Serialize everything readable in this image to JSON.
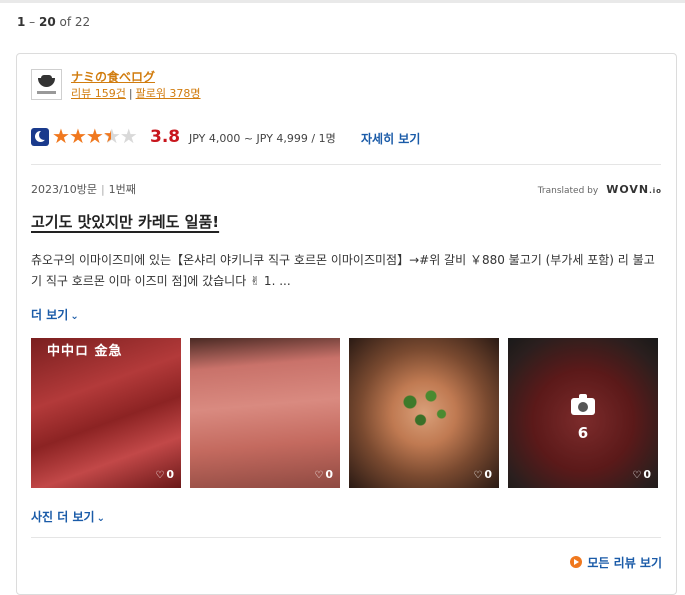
{
  "pagination": {
    "range_start": "1",
    "range_sep": " – ",
    "range_end": "20",
    "of_label": " of 22"
  },
  "reviewer": {
    "name": "ナミの食べログ",
    "reviews_label": "리뷰 159건",
    "followers_label": "팔로워 378명",
    "separator": "|"
  },
  "rating": {
    "stars": 3.8,
    "score": "3.8",
    "price_range": "JPY 4,000 ~ JPY 4,999 / 1명",
    "detail_link": "자세히 보기"
  },
  "visit": {
    "date": "2023/10방문",
    "separator": "|",
    "count": "1번째"
  },
  "translation": {
    "label": "Translated by",
    "brand": "WOVN",
    "brand_suffix": ".io"
  },
  "review": {
    "title": "고기도 맛있지만 카레도 일품!",
    "body": "츄오구의 이마이즈미에 있는【온샤리 야키니쿠 직구 호르몬 이마이즈미점】→#위 갈비 ￥880 불고기 (부가세 포함) 리 불고기 직구 호르몬 이마 이즈미 점]에 갔습니다 ✌ 1. ...",
    "more_link": "더 보기"
  },
  "photos": [
    {
      "name": "photo-1",
      "overlay_text": "中中ロ   金急",
      "likes": "0"
    },
    {
      "name": "photo-2",
      "likes": "0"
    },
    {
      "name": "photo-3",
      "likes": "0"
    },
    {
      "name": "photo-4",
      "more_count": "6",
      "likes": "0"
    }
  ],
  "photos_more_link": "사진 더 보기",
  "all_reviews_link": "모든 리뷰 보기",
  "colors": {
    "accent_orange": "#f0781e",
    "score_red": "#c8161d",
    "link_blue": "#1a5ba8",
    "user_orange": "#d17c0e"
  }
}
